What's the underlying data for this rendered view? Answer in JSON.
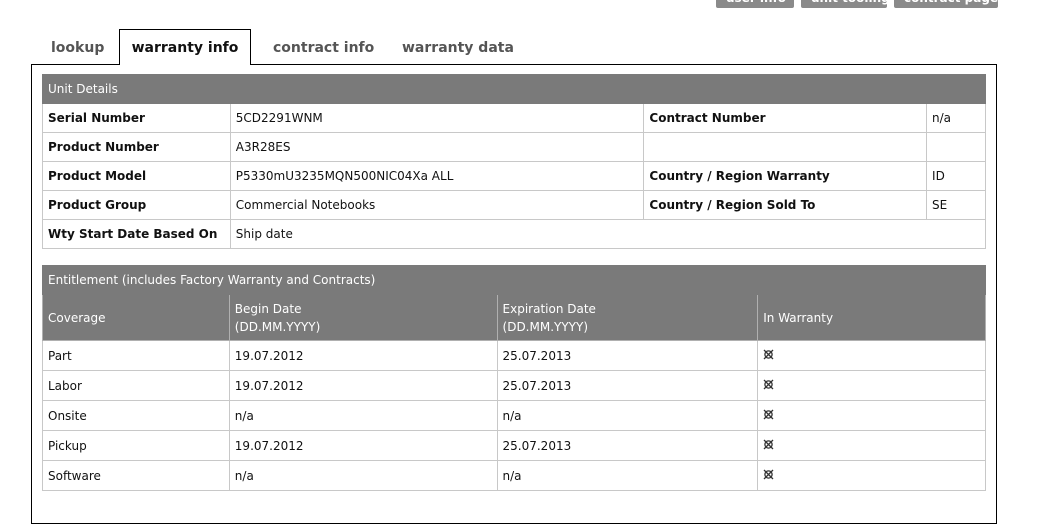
{
  "top_buttons": [
    "user info",
    "unit tooling",
    "contract page"
  ],
  "tabs": [
    {
      "label": "lookup"
    },
    {
      "label": "warranty info",
      "active": true
    },
    {
      "label": "contract info"
    },
    {
      "label": "warranty data"
    }
  ],
  "unit_details": {
    "title": "Unit Details",
    "rows": [
      {
        "l1": "Serial Number",
        "v1": "5CD2291WNM",
        "l2": "Contract Number",
        "v2": "n/a"
      },
      {
        "l1": "Product Number",
        "v1": "A3R28ES",
        "l2": "",
        "v2": ""
      },
      {
        "l1": "Product Model",
        "v1": "P5330mU3235MQN500NIC04Xa ALL",
        "l2": "Country / Region Warranty",
        "v2": "ID"
      },
      {
        "l1": "Product Group",
        "v1": "Commercial Notebooks",
        "l2": "Country / Region Sold To",
        "v2": "SE"
      },
      {
        "l1": "Wty Start Date Based On",
        "v1": "Ship date"
      }
    ]
  },
  "entitlement": {
    "title": "Entitlement (includes Factory Warranty and Contracts)",
    "columns": [
      "Coverage",
      "Begin Date",
      "(DD.MM.YYYY)",
      "Expiration Date",
      "(DD.MM.YYYY)",
      "In Warranty"
    ],
    "rows": [
      {
        "coverage": "Part",
        "begin": "19.07.2012",
        "expire": "25.07.2013",
        "icon": "no-warranty-icon"
      },
      {
        "coverage": "Labor",
        "begin": "19.07.2012",
        "expire": "25.07.2013",
        "icon": "no-warranty-icon"
      },
      {
        "coverage": "Onsite",
        "begin": "n/a",
        "expire": "n/a",
        "icon": "no-warranty-icon"
      },
      {
        "coverage": "Pickup",
        "begin": "19.07.2012",
        "expire": "25.07.2013",
        "icon": "no-warranty-icon"
      },
      {
        "coverage": "Software",
        "begin": "n/a",
        "expire": "n/a",
        "icon": "no-warranty-icon"
      }
    ]
  },
  "colors": {
    "header_bg": "#7a7a7a",
    "border": "#c8c8c8"
  }
}
